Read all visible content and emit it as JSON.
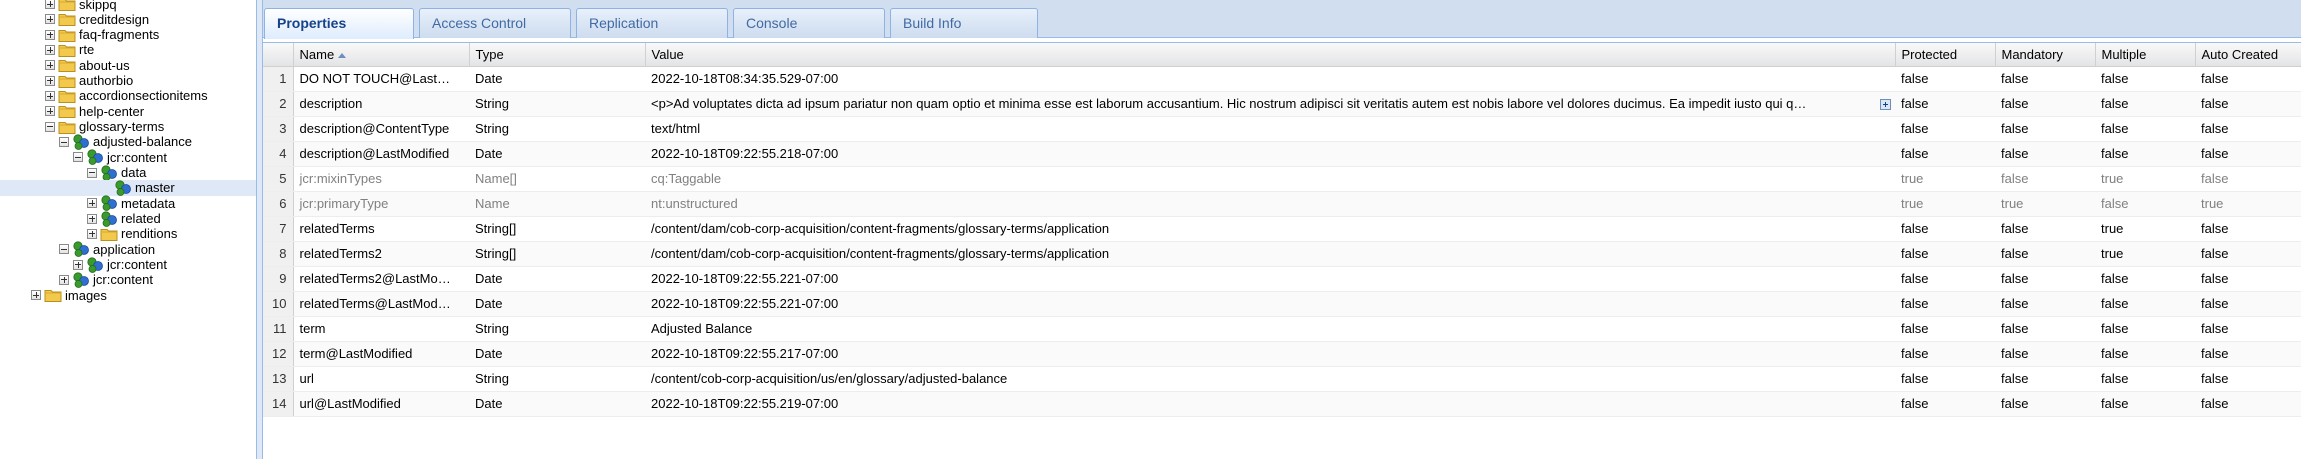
{
  "tree": {
    "nodes": [
      {
        "label": "skippq",
        "icon": "folder-icon",
        "expander": "plus"
      },
      {
        "label": "creditdesign",
        "icon": "folder-icon",
        "expander": "plus"
      },
      {
        "label": "faq-fragments",
        "icon": "folder-icon",
        "expander": "plus"
      },
      {
        "label": "rte",
        "icon": "folder-icon",
        "expander": "plus"
      },
      {
        "label": "about-us",
        "icon": "folder-icon",
        "expander": "plus"
      },
      {
        "label": "authorbio",
        "icon": "folder-icon",
        "expander": "plus"
      },
      {
        "label": "accordionsectionitems",
        "icon": "folder-icon",
        "expander": "plus"
      },
      {
        "label": "help-center",
        "icon": "folder-icon",
        "expander": "plus"
      },
      {
        "label": "glossary-terms",
        "icon": "folder-icon",
        "expander": "minus"
      },
      {
        "label": "adjusted-balance",
        "icon": "node-icon",
        "expander": "minus"
      },
      {
        "label": "jcr:content",
        "icon": "node-icon",
        "expander": "minus"
      },
      {
        "label": "data",
        "icon": "node-icon",
        "expander": "minus"
      },
      {
        "label": "master",
        "icon": "node-icon",
        "expander": "none",
        "selected": true
      },
      {
        "label": "metadata",
        "icon": "node-icon",
        "expander": "plus"
      },
      {
        "label": "related",
        "icon": "node-icon",
        "expander": "plus"
      },
      {
        "label": "renditions",
        "icon": "folder-icon",
        "expander": "plus"
      },
      {
        "label": "application",
        "icon": "node-icon",
        "expander": "minus"
      },
      {
        "label": "jcr:content",
        "icon": "node-icon",
        "expander": "plus"
      },
      {
        "label": "jcr:content",
        "icon": "node-icon",
        "expander": "plus"
      },
      {
        "label": "images",
        "icon": "folder-icon",
        "expander": "plus"
      }
    ]
  },
  "tabs": [
    {
      "label": "Properties",
      "active": true
    },
    {
      "label": "Access Control"
    },
    {
      "label": "Replication"
    },
    {
      "label": "Console"
    },
    {
      "label": "Build Info"
    }
  ],
  "grid": {
    "columns": [
      "",
      "Name",
      "Type",
      "Value",
      "Protected",
      "Mandatory",
      "Multiple",
      "Auto Created"
    ],
    "rows": [
      {
        "num": "1",
        "name": "DO NOT TOUCH@Last…",
        "type": "Date",
        "value": "2022-10-18T08:34:35.529-07:00",
        "protected": "false",
        "mandatory": "false",
        "multiple": "false",
        "auto": "false"
      },
      {
        "num": "2",
        "name": "description",
        "type": "String",
        "value": "<p>Ad voluptates dicta ad ipsum pariatur non quam optio et minima esse est laborum accusantium. Hic nostrum adipisci sit veritatis autem est nobis labore vel dolores ducimus. Ea impedit iusto qui q…",
        "protected": "false",
        "mandatory": "false",
        "multiple": "false",
        "auto": "false",
        "expandable": true
      },
      {
        "num": "3",
        "name": "description@ContentType",
        "type": "String",
        "value": "text/html",
        "protected": "false",
        "mandatory": "false",
        "multiple": "false",
        "auto": "false"
      },
      {
        "num": "4",
        "name": "description@LastModified",
        "type": "Date",
        "value": "2022-10-18T09:22:55.218-07:00",
        "protected": "false",
        "mandatory": "false",
        "multiple": "false",
        "auto": "false"
      },
      {
        "num": "5",
        "name": "jcr:mixinTypes",
        "type": "Name[]",
        "value": "cq:Taggable",
        "protected": "true",
        "mandatory": "false",
        "multiple": "true",
        "auto": "false",
        "isProtected": true
      },
      {
        "num": "6",
        "name": "jcr:primaryType",
        "type": "Name",
        "value": "nt:unstructured",
        "protected": "true",
        "mandatory": "true",
        "multiple": "false",
        "auto": "true",
        "isProtected": true
      },
      {
        "num": "7",
        "name": "relatedTerms",
        "type": "String[]",
        "value": "/content/dam/cob-corp-acquisition/content-fragments/glossary-terms/application",
        "protected": "false",
        "mandatory": "false",
        "multiple": "true",
        "auto": "false"
      },
      {
        "num": "8",
        "name": "relatedTerms2",
        "type": "String[]",
        "value": "/content/dam/cob-corp-acquisition/content-fragments/glossary-terms/application",
        "protected": "false",
        "mandatory": "false",
        "multiple": "true",
        "auto": "false"
      },
      {
        "num": "9",
        "name": "relatedTerms2@LastMo…",
        "type": "Date",
        "value": "2022-10-18T09:22:55.221-07:00",
        "protected": "false",
        "mandatory": "false",
        "multiple": "false",
        "auto": "false"
      },
      {
        "num": "10",
        "name": "relatedTerms@LastMod…",
        "type": "Date",
        "value": "2022-10-18T09:22:55.221-07:00",
        "protected": "false",
        "mandatory": "false",
        "multiple": "false",
        "auto": "false"
      },
      {
        "num": "11",
        "name": "term",
        "type": "String",
        "value": "Adjusted Balance",
        "protected": "false",
        "mandatory": "false",
        "multiple": "false",
        "auto": "false"
      },
      {
        "num": "12",
        "name": "term@LastModified",
        "type": "Date",
        "value": "2022-10-18T09:22:55.217-07:00",
        "protected": "false",
        "mandatory": "false",
        "multiple": "false",
        "auto": "false"
      },
      {
        "num": "13",
        "name": "url",
        "type": "String",
        "value": "/content/cob-corp-acquisition/us/en/glossary/adjusted-balance",
        "protected": "false",
        "mandatory": "false",
        "multiple": "false",
        "auto": "false"
      },
      {
        "num": "14",
        "name": "url@LastModified",
        "type": "Date",
        "value": "2022-10-18T09:22:55.219-07:00",
        "protected": "false",
        "mandatory": "false",
        "multiple": "false",
        "auto": "false"
      }
    ]
  },
  "colors": {
    "folder": "#f2c94c",
    "node_blue": "#2f6fd0",
    "node_green": "#3a9a2e",
    "tab_text": "#15428b",
    "selected_bg": "#dfe8f6"
  }
}
